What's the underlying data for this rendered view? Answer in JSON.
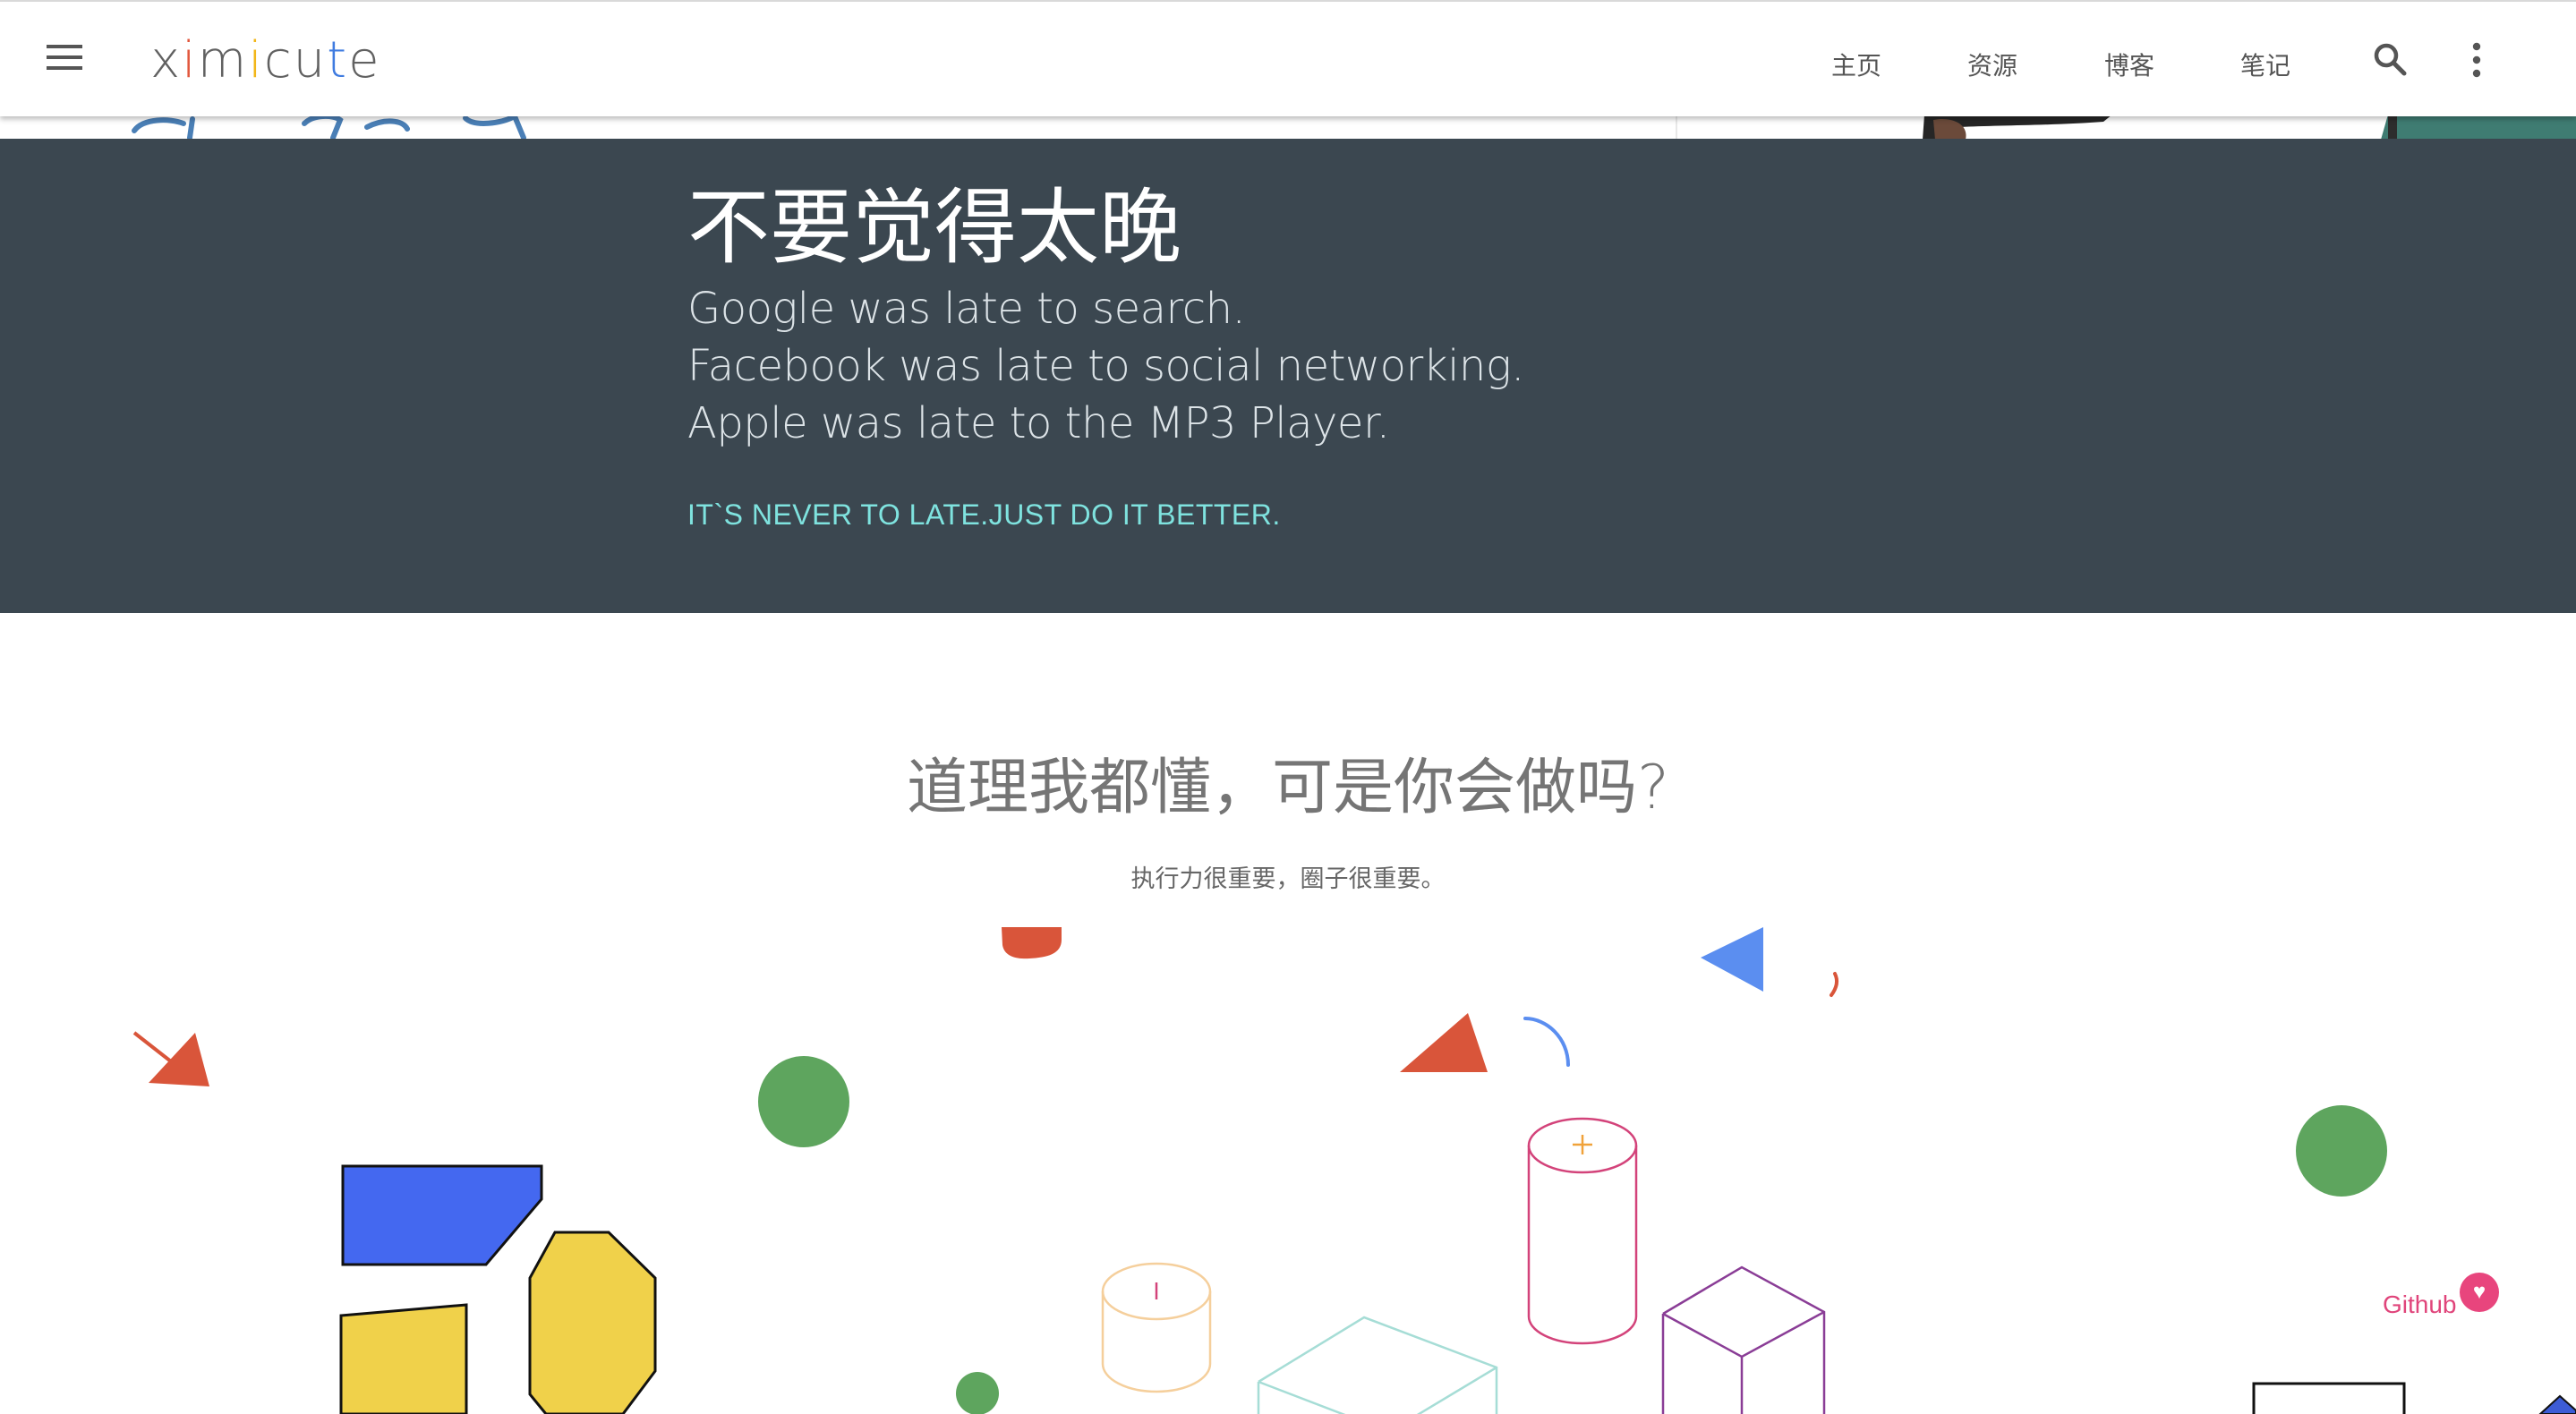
{
  "header": {
    "logo": {
      "letters": [
        {
          "char": "x",
          "color": "#616161"
        },
        {
          "char": "i",
          "color": "#e2583e"
        },
        {
          "char": "m",
          "color": "#616161"
        },
        {
          "char": "i",
          "color": "#f2b618"
        },
        {
          "char": "c",
          "color": "#616161"
        },
        {
          "char": "u",
          "color": "#616161"
        },
        {
          "char": "t",
          "color": "#3f7be0"
        },
        {
          "char": "e",
          "color": "#616161"
        }
      ]
    },
    "nav": [
      "主页",
      "资源",
      "博客",
      "笔记"
    ],
    "icons": {
      "menu": "menu-icon",
      "search": "search-icon",
      "more": "more-vert-icon"
    }
  },
  "hero": {
    "title": "不要觉得太晚",
    "lines": [
      "Google was late to search.",
      "Facebook was late to social networking.",
      "Apple was late to the MP3 Player."
    ],
    "cta": "IT`S NEVER TO LATE.JUST DO IT BETTER.",
    "colors": {
      "background": "#3b4750",
      "accent": "#7fe3df"
    }
  },
  "section": {
    "title": "道理我都懂，可是你会做吗?",
    "subtitle": "执行力很重要，圈子很重要。"
  },
  "github": {
    "label": "Github",
    "icon": "heart-icon",
    "color": "#e8457d"
  }
}
